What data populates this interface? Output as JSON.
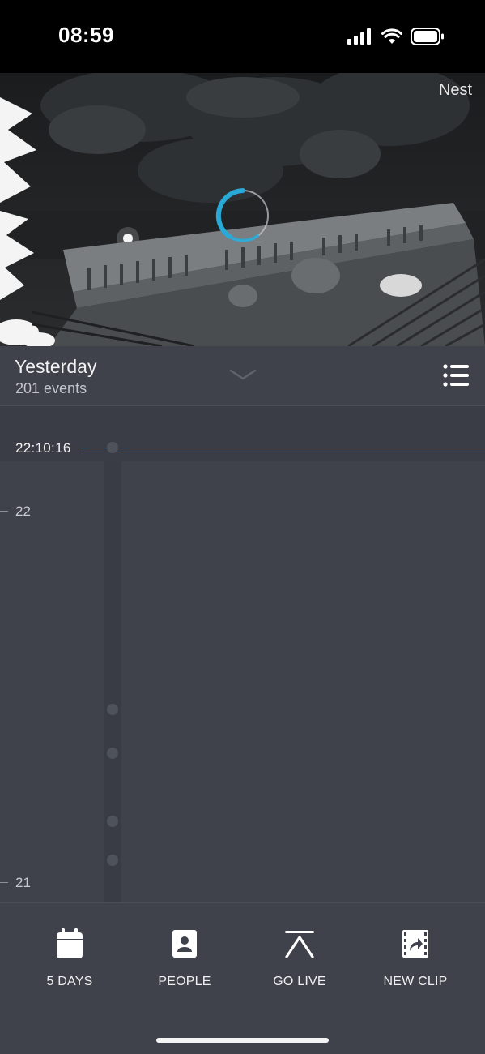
{
  "status_bar": {
    "time": "08:59",
    "icons": [
      "signal-icon",
      "wifi-icon",
      "battery-icon"
    ]
  },
  "camera": {
    "brand": "Nest",
    "loading": true,
    "spinner_color": "#29a9d6"
  },
  "timeline_header": {
    "day": "Yesterday",
    "event_count": "201 events",
    "expand_icon": "chevron-down-icon",
    "list_icon": "list-icon"
  },
  "timeline": {
    "cursor_time": "22:10:16",
    "hour_labels": [
      "22",
      "21"
    ],
    "cursor_line_color": "#5d86b0"
  },
  "toolbar": {
    "items": [
      {
        "label": "5 DAYS",
        "icon": "calendar-icon"
      },
      {
        "label": "PEOPLE",
        "icon": "person-badge-icon"
      },
      {
        "label": "GO LIVE",
        "icon": "go-live-icon"
      },
      {
        "label": "NEW CLIP",
        "icon": "new-clip-icon"
      }
    ]
  }
}
